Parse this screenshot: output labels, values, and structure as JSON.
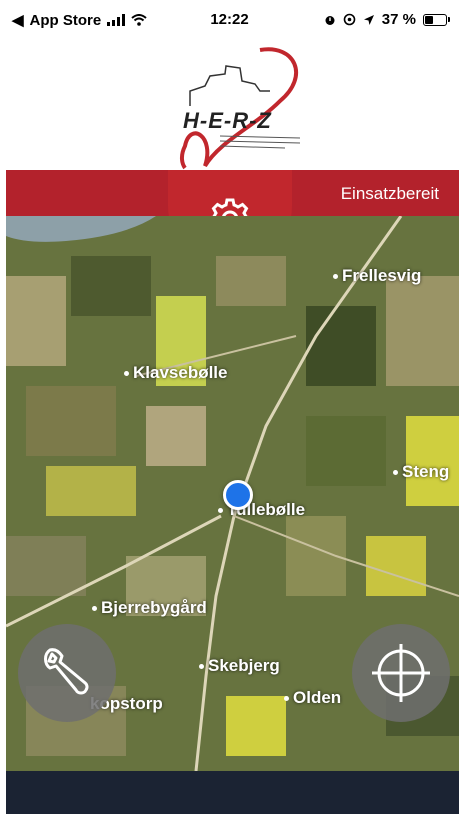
{
  "status_bar": {
    "back_app": "App Store",
    "time": "12:22",
    "battery": "37 %",
    "battery_level": 0.37
  },
  "logo": {
    "text": "H-E-R-Z"
  },
  "header": {
    "status": "Einsatzbereit"
  },
  "map": {
    "places": [
      {
        "name": "Frellesvig"
      },
      {
        "name": "Klavsebølle"
      },
      {
        "name": "Steng"
      },
      {
        "name": "Tullebølle"
      },
      {
        "name": "Bjerrebygård"
      },
      {
        "name": "Skebjerg"
      },
      {
        "name": "kopstorp"
      },
      {
        "name": "Olden"
      }
    ]
  },
  "colors": {
    "brand_red": "#b3222c",
    "location_blue": "#1e73e8",
    "bottom_bar": "#1b2333"
  },
  "icons": {
    "settings": "gear-icon",
    "tools": "wrench-icon",
    "recenter": "crosshair-icon"
  }
}
